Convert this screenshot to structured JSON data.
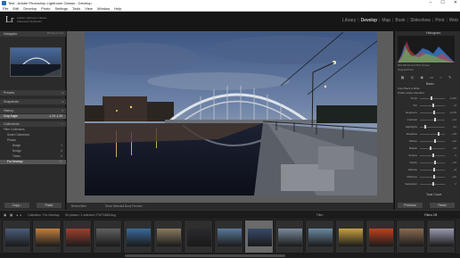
{
  "window": {
    "title": "Test - Adobe Photoshop Lightroom Classic - Develop",
    "controls": [
      "–",
      "☐",
      "✕"
    ]
  },
  "menu": [
    "File",
    "Edit",
    "Develop",
    "Photo",
    "Settings",
    "Tools",
    "View",
    "Window",
    "Help"
  ],
  "identity": {
    "logo": "Lr",
    "line1": "Adobe Lightroom Classic",
    "line2": "Advanced Textbooks"
  },
  "modules": [
    "Library",
    "Develop",
    "Map",
    "Book",
    "Slideshow",
    "Print",
    "Web"
  ],
  "active_module": "Develop",
  "left_panel": {
    "navigator": "Navigator",
    "nav_zoom": "FIT  FILL  1:1  3:1",
    "presets": "Presets",
    "snapshots": "Snapshots",
    "history": "History",
    "history_item": "Crop Angle",
    "history_vals": "-1.25   -1.25",
    "collections": "Collections",
    "collection_rows": [
      {
        "label": "Filter Collections",
        "count": ""
      },
      {
        "label": "Smart Collections",
        "count": ""
      },
      {
        "label": "Photos",
        "count": ""
      },
      {
        "label": "Bridge",
        "count": "3"
      },
      {
        "label": "Design",
        "count": "8"
      },
      {
        "label": "Tubes",
        "count": "6"
      },
      {
        "label": "For Develop",
        "count": "54"
      }
    ],
    "copy_button": "Copy...",
    "paste_button": "Paste"
  },
  "center": {
    "view_options": "Before/After",
    "soft_proof": "Show Selected Book Preview"
  },
  "right_panel": {
    "histogram_label": "Histogram",
    "photo_info": "ISO 100   24 mm   f/8.0   1/2 sec",
    "original_photo": "Original Photo",
    "basic_label": "Basic",
    "treatment": "Color   Black & White",
    "profile": "Profile: Adobe Standard",
    "sliders": [
      {
        "label": "Temp",
        "value": "4,200",
        "pos": 0.45
      },
      {
        "label": "Tint",
        "value": "+6",
        "pos": 0.52
      },
      {
        "label": "Exposure",
        "value": "+0.35",
        "pos": 0.56
      },
      {
        "label": "Contrast",
        "value": "+12",
        "pos": 0.58
      },
      {
        "label": "Highlights",
        "value": "-62",
        "pos": 0.2
      },
      {
        "label": "Shadows",
        "value": "+48",
        "pos": 0.75
      },
      {
        "label": "Whites",
        "value": "+20",
        "pos": 0.6
      },
      {
        "label": "Blacks",
        "value": "-18",
        "pos": 0.4
      },
      {
        "label": "Texture",
        "value": "0",
        "pos": 0.5
      },
      {
        "label": "Clarity",
        "value": "+15",
        "pos": 0.6
      },
      {
        "label": "Dehaze",
        "value": "+8",
        "pos": 0.55
      },
      {
        "label": "Vibrance",
        "value": "+10",
        "pos": 0.56
      },
      {
        "label": "Saturation",
        "value": "0",
        "pos": 0.5
      }
    ],
    "tone_curve": "Tone Curve",
    "previous_button": "Previous",
    "reset_button": "Reset"
  },
  "filmstrip_bar": {
    "source": "Collection : For Develop",
    "count": "54 photos / 1 selected / P1070889.dng",
    "filter_label": "Filter :",
    "filter_value": "Filters Off"
  },
  "filmstrip_count": 15,
  "filmstrip_active_index": 8
}
